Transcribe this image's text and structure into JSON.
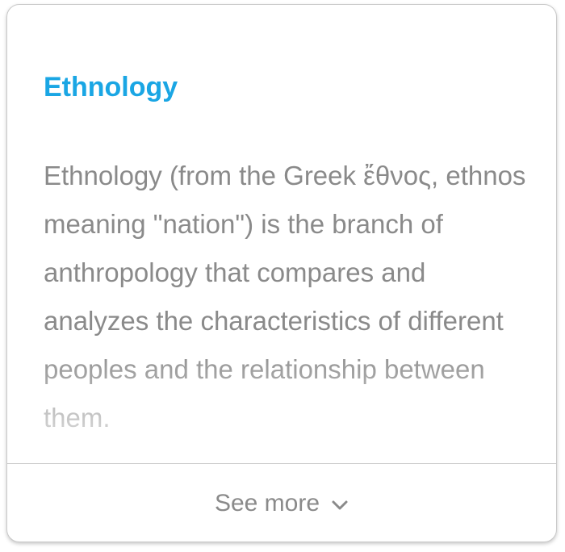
{
  "card": {
    "title": "Ethnology",
    "body": "Ethnology (from the Greek ἔθνος, ethnos meaning \"nation\") is the branch of anthropology that compares and analyzes the characteristics of different peoples and the relationship between them.",
    "see_more_label": "See more",
    "see_more_icon": "chevron-down-icon",
    "accent_color": "#1aa6e4",
    "text_color": "#8a8a8a"
  }
}
